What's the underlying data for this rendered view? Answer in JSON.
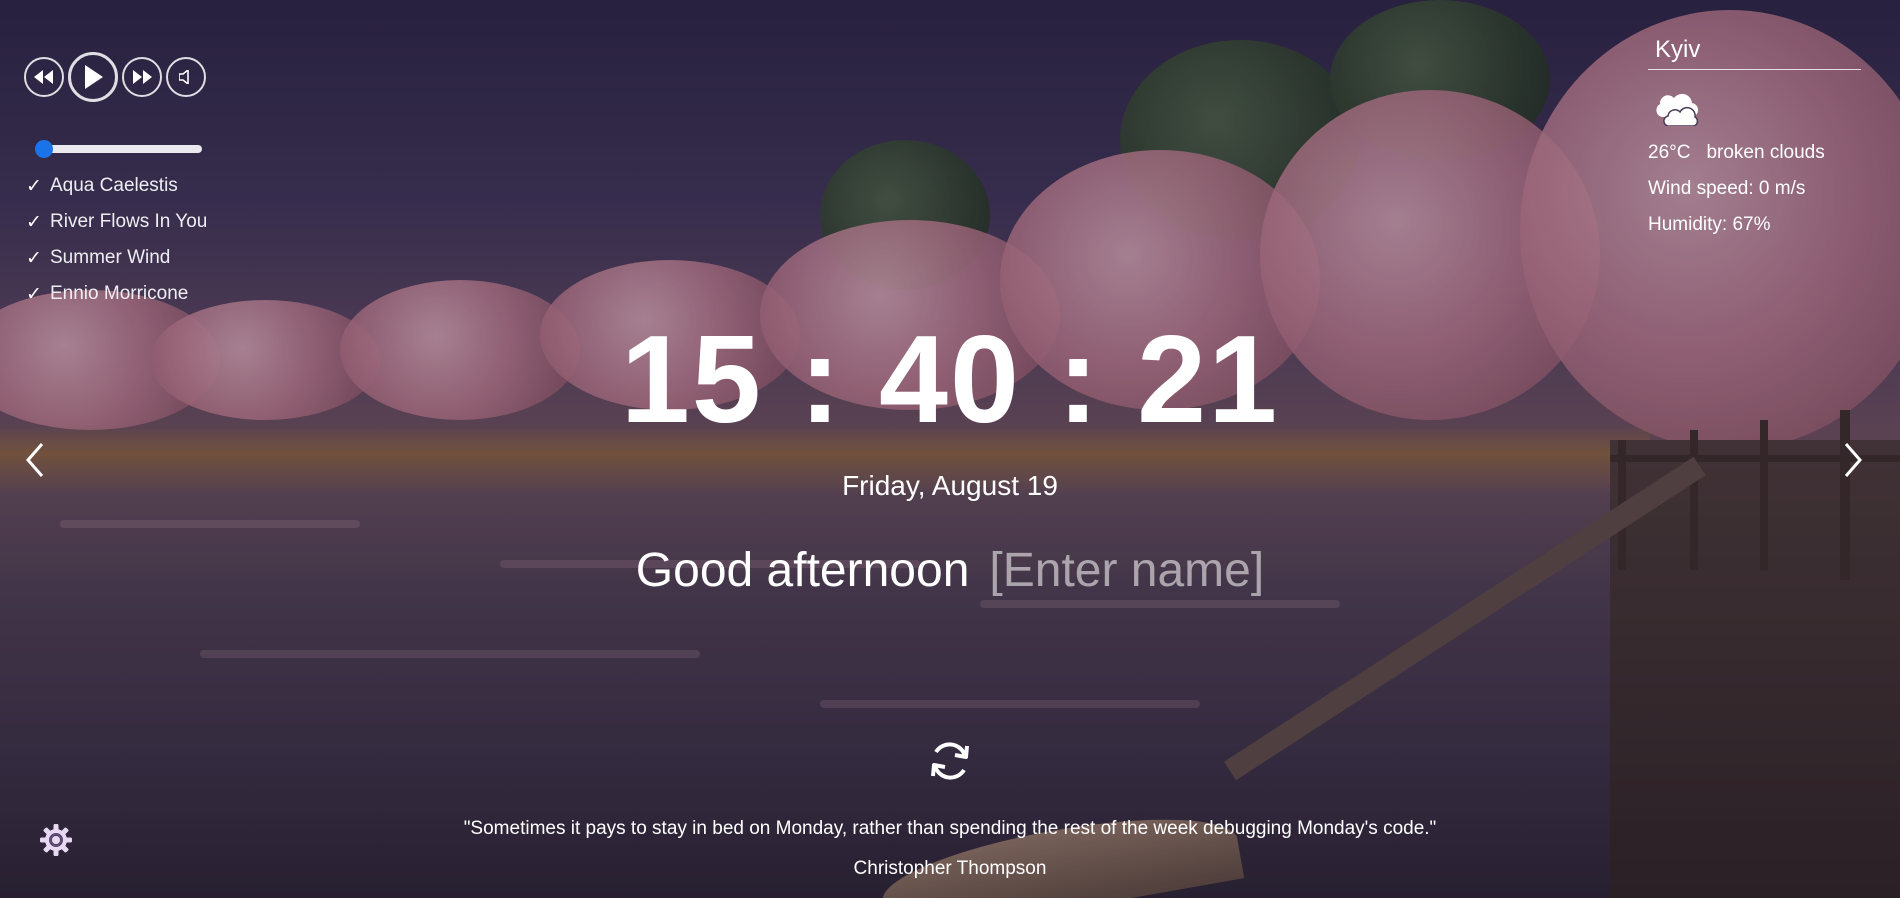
{
  "player": {
    "controls": [
      "rewind-icon",
      "play-icon",
      "fast-forward-icon",
      "volume-icon"
    ],
    "progress_fraction": 0.0,
    "playlist": [
      {
        "check": "✓",
        "title": "Aqua Caelestis"
      },
      {
        "check": "✓",
        "title": "River Flows In You"
      },
      {
        "check": "✓",
        "title": "Summer Wind"
      },
      {
        "check": "✓",
        "title": "Ennio Morricone"
      }
    ]
  },
  "weather": {
    "city": "Kyiv",
    "icon": "broken-clouds-icon",
    "temperature": "26°C",
    "description": "broken clouds",
    "wind": "Wind speed: 0 m/s",
    "humidity": "Humidity: 67%"
  },
  "clock": {
    "time": "15 : 40 : 21",
    "date": "Friday, August 19"
  },
  "greeting": {
    "text": "Good afternoon",
    "name_placeholder": "[Enter name]"
  },
  "navigation": {
    "prev_icon": "chevron-left-icon",
    "next_icon": "chevron-right-icon"
  },
  "quote": {
    "refresh_icon": "refresh-icon",
    "text": "\"Sometimes it pays to stay in bed on Monday, rather than spending the rest of the week debugging Monday's code.\"",
    "author": "Christopher Thompson"
  },
  "settings": {
    "icon": "gear-icon",
    "color": "#e8d8f4"
  },
  "colors": {
    "progress_track": "#e9e9ee",
    "progress_thumb": "#1a73e8",
    "text": "#ffffff"
  }
}
